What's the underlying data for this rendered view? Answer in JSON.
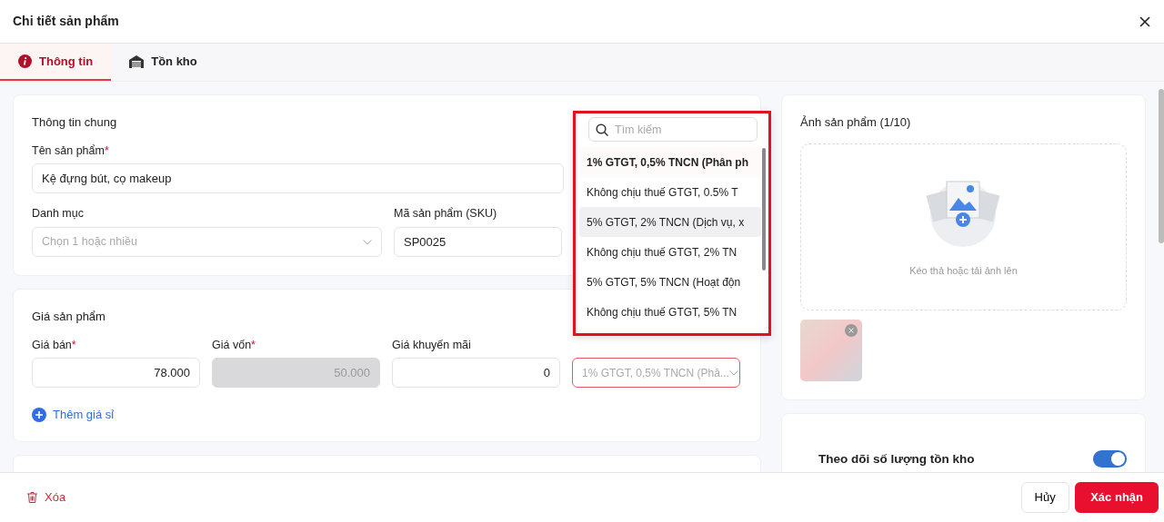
{
  "window": {
    "title": "Chi tiết sản phẩm"
  },
  "tabs": [
    {
      "label": "Thông tin",
      "kind": "info",
      "selected": true
    },
    {
      "label": "Tồn kho",
      "kind": "warehouse",
      "selected": false
    }
  ],
  "required_mark": "*",
  "general": {
    "title": "Thông tin chung",
    "name_label": "Tên sản phẩm",
    "name_required": true,
    "name_value": "Kệ đựng bút, cọ makeup",
    "category_label": "Danh mục",
    "category_placeholder": "Chọn 1 hoặc nhiều",
    "sku_label": "Mã sản phẩm (SKU)",
    "sku_value": "SP0025"
  },
  "price": {
    "title": "Giá sản phẩm",
    "fields": [
      {
        "label": "Giá bán",
        "required": true,
        "value": "78.000",
        "disabled": false
      },
      {
        "label": "Giá vốn",
        "required": true,
        "value": "50.000",
        "disabled": true
      },
      {
        "label": "Giá khuyến mãi",
        "required": false,
        "value": "0",
        "disabled": false
      }
    ],
    "tax_value": "1% GTGT, 0,5% TNCN (Phâ...",
    "add_wholesale": "Thêm giá sỉ"
  },
  "dropdown": {
    "search_placeholder": "Tìm kiếm",
    "options": [
      {
        "label": "1% GTGT, 0,5% TNCN (Phân ph",
        "selected": true,
        "hovered": false
      },
      {
        "label": "Không chịu thuế GTGT, 0.5% T",
        "selected": false,
        "hovered": false
      },
      {
        "label": "5% GTGT, 2% TNCN (Dịch vụ, x",
        "selected": false,
        "hovered": true
      },
      {
        "label": "Không chịu thuế GTGT, 2% TN",
        "selected": false,
        "hovered": false
      },
      {
        "label": "5% GTGT, 5% TNCN (Hoạt độn",
        "selected": false,
        "hovered": false
      },
      {
        "label": "Không chịu thuế GTGT, 5% TN",
        "selected": false,
        "hovered": false
      }
    ]
  },
  "images": {
    "title": "Ảnh sản phẩm (1/10)",
    "upload_hint": "Kéo thả hoặc tải ảnh lên"
  },
  "inventory": {
    "label": "Theo dõi số lượng tồn kho",
    "on": true
  },
  "footer": {
    "delete": "Xóa",
    "cancel": "Hủy",
    "confirm": "Xác nhận"
  }
}
